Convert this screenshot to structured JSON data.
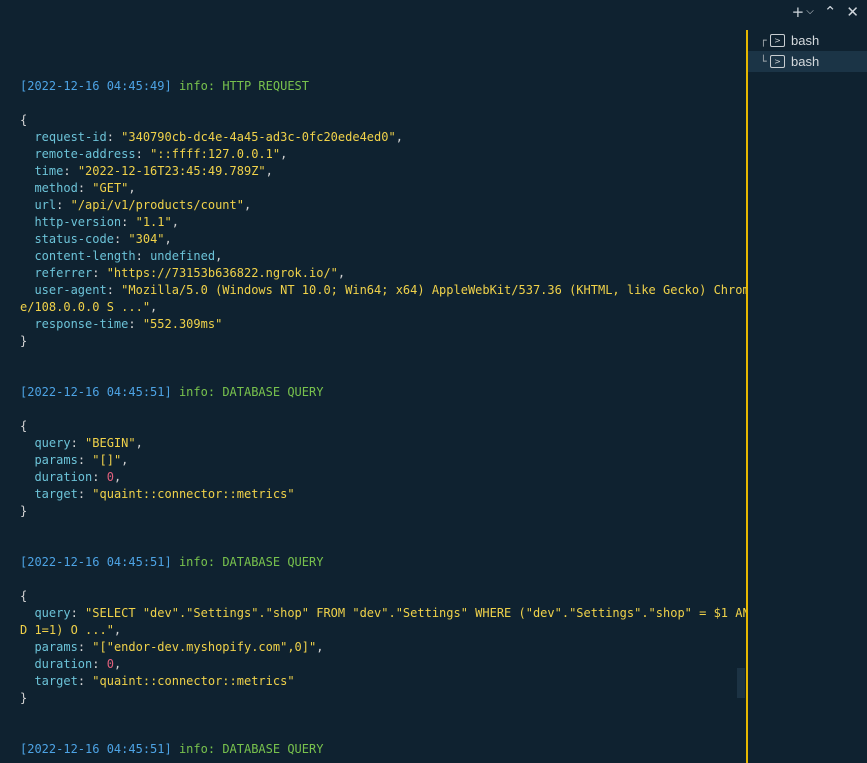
{
  "toolbar": {
    "new_terminal_glyph": "+",
    "dropdown_glyph": "⌵",
    "maximize_glyph": "⌃",
    "close_glyph": "✕"
  },
  "terminals": [
    {
      "tree": "┌",
      "name": "bash"
    },
    {
      "tree": "└",
      "name": "bash"
    }
  ],
  "log": {
    "entries": [
      {
        "timestamp_date": "[2022-12-16 ",
        "timestamp_time": "04:45:49]",
        "level": " info: ",
        "message": "HTTP REQUEST",
        "fields": [
          {
            "key": "request-id",
            "value": "\"340790cb-dc4e-4a45-ad3c-0fc20ede4ed0\"",
            "type": "s"
          },
          {
            "key": "remote-address",
            "value": "\"::ffff:127.0.0.1\"",
            "type": "s"
          },
          {
            "key": "time",
            "value": "\"2022-12-16T23:45:49.789Z\"",
            "type": "s"
          },
          {
            "key": "method",
            "value": "\"GET\"",
            "type": "s"
          },
          {
            "key": "url",
            "value": "\"/api/v1/products/count\"",
            "type": "s"
          },
          {
            "key": "http-version",
            "value": "\"1.1\"",
            "type": "s"
          },
          {
            "key": "status-code",
            "value": "\"304\"",
            "type": "s"
          },
          {
            "key": "content-length",
            "value": "undefined",
            "type": "u"
          },
          {
            "key": "referrer",
            "value": "\"https://73153b636822.ngrok.io/\"",
            "type": "s"
          },
          {
            "key": "user-agent",
            "value": "\"Mozilla/5.0 (Windows NT 10.0; Win64; x64) AppleWebKit/537.36 (KHTML, like Gecko) Chrom",
            "type": "s",
            "wrap": "e/108.0.0.0 S ...\""
          },
          {
            "key": "response-time",
            "value": "\"552.309ms\"",
            "type": "s"
          }
        ]
      },
      {
        "timestamp_date": "[2022-12-16 ",
        "timestamp_time": "04:45:51]",
        "level": " info: ",
        "message": "DATABASE QUERY",
        "fields": [
          {
            "key": "query",
            "value": "\"BEGIN\"",
            "type": "s"
          },
          {
            "key": "params",
            "value": "\"[]\"",
            "type": "s"
          },
          {
            "key": "duration",
            "value": "0",
            "type": "n"
          },
          {
            "key": "target",
            "value": "\"quaint::connector::metrics\"",
            "type": "s"
          }
        ]
      },
      {
        "timestamp_date": "[2022-12-16 ",
        "timestamp_time": "04:45:51]",
        "level": " info: ",
        "message": "DATABASE QUERY",
        "fields": [
          {
            "key": "query",
            "value": "\"SELECT \"dev\".\"Settings\".\"shop\" FROM \"dev\".\"Settings\" WHERE (\"dev\".\"Settings\".\"shop\" = $1 AN",
            "type": "s",
            "wrap": "D 1=1) O ...\""
          },
          {
            "key": "params",
            "value": "\"[\"endor-dev.myshopify.com\",0]\"",
            "type": "s"
          },
          {
            "key": "duration",
            "value": "0",
            "type": "n"
          },
          {
            "key": "target",
            "value": "\"quaint::connector::metrics\"",
            "type": "s"
          }
        ]
      },
      {
        "timestamp_date": "[2022-12-16 ",
        "timestamp_time": "04:45:51]",
        "level": " info: ",
        "message": "DATABASE QUERY",
        "fields": []
      }
    ]
  }
}
